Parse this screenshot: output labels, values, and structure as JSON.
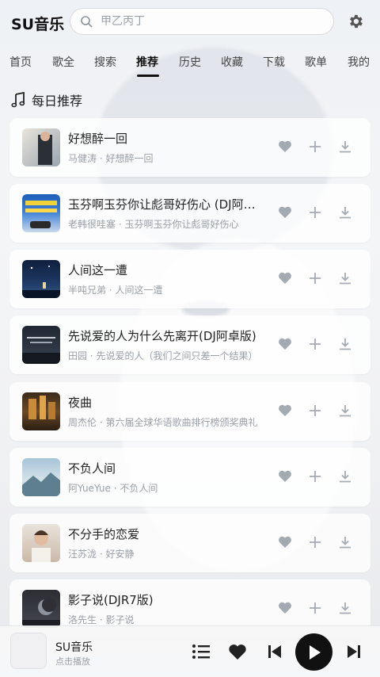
{
  "app": {
    "title": "SU音乐"
  },
  "search": {
    "placeholder": "甲乙丙丁"
  },
  "tabs": [
    "首页",
    "歌全",
    "搜索",
    "推荐",
    "历史",
    "收藏",
    "下载",
    "歌单",
    "我的"
  ],
  "active_tab": "推荐",
  "section": {
    "title": "每日推荐"
  },
  "songs": [
    {
      "title": "好想醉一回",
      "subtitle": "马健涛 · 好想醉一回"
    },
    {
      "title": "玉芬啊玉芬你让彪哥好伤心 (DJ阿卓版)",
      "subtitle": "老韩很哇塞 · 玉芬啊玉芬你让彪哥好伤心"
    },
    {
      "title": "人间这一遭",
      "subtitle": "半吨兄弟 · 人间这一遭"
    },
    {
      "title": "先说爱的人为什么先离开(DJ阿卓版)",
      "subtitle": "田园 · 先说爱的人（我们之间只差一个结果）"
    },
    {
      "title": "夜曲",
      "subtitle": "周杰伦 · 第六届全球华语歌曲排行榜颁奖典礼"
    },
    {
      "title": "不负人间",
      "subtitle": "阿YueYue · 不负人间"
    },
    {
      "title": "不分手的恋爱",
      "subtitle": "汪苏泷 · 好安静"
    },
    {
      "title": "影子说(DJR7版)",
      "subtitle": "洛先生 · 影子说"
    }
  ],
  "player": {
    "title": "SU音乐",
    "subtitle": "点击播放"
  },
  "colors": {
    "accent": "#111111",
    "icon_gray": "#9aa0a8",
    "card_bg": "#ffffff"
  }
}
